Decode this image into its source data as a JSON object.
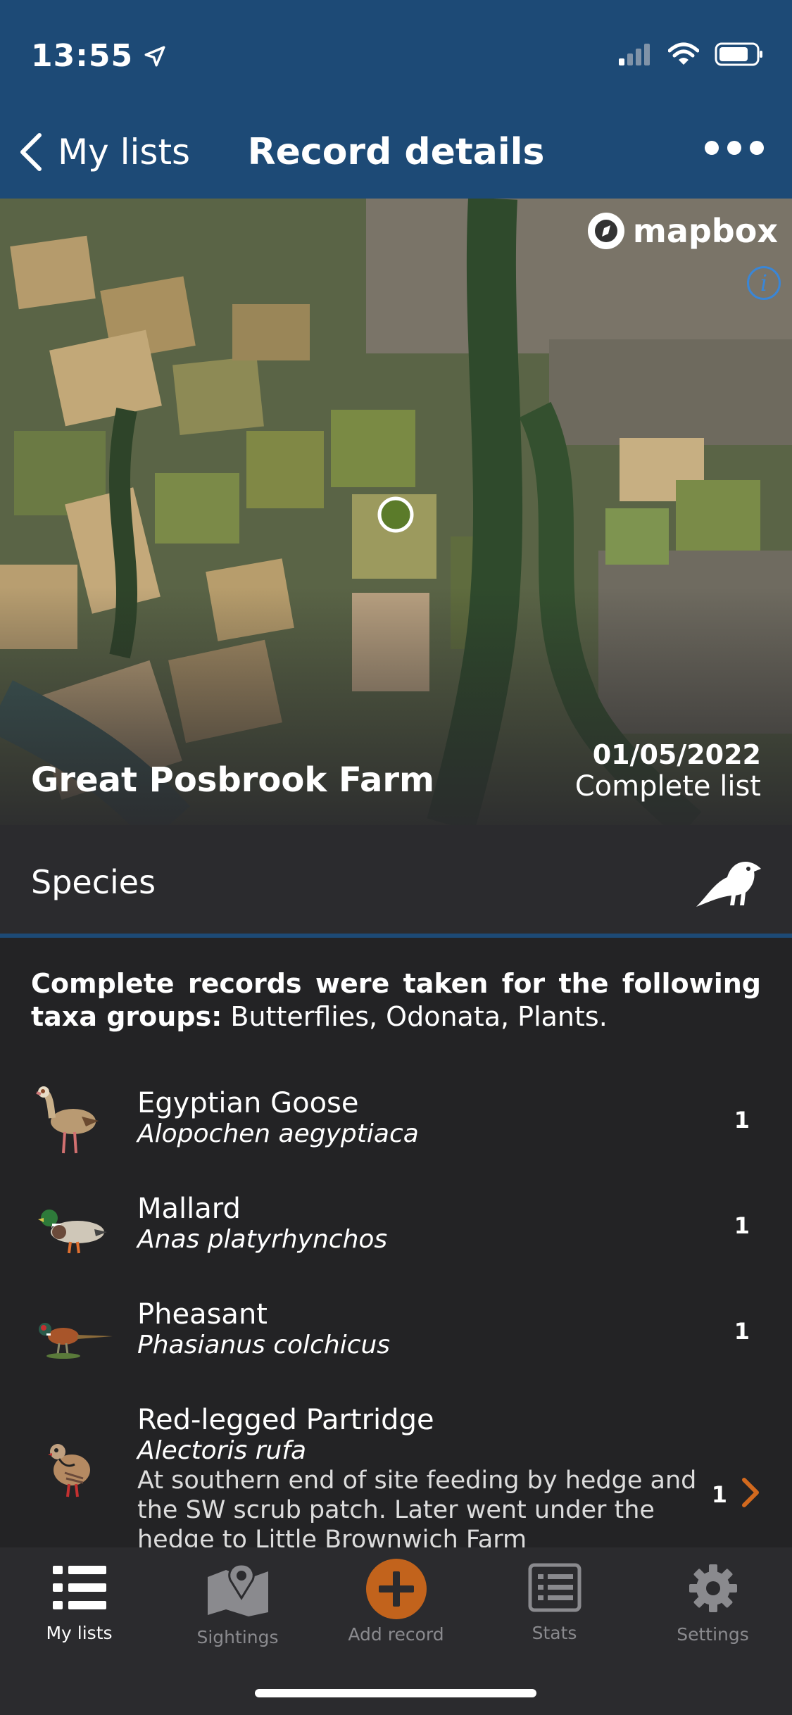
{
  "status_bar": {
    "time": "13:55"
  },
  "nav": {
    "back_label": "My lists",
    "title": "Record details"
  },
  "map": {
    "attribution": "mapbox",
    "info": "i"
  },
  "record": {
    "location": "Great Posbrook Farm",
    "date": "01/05/2022",
    "list_type": "Complete list"
  },
  "species_section": {
    "title": "Species"
  },
  "complete_note": {
    "prefix": "Complete records were taken for the following taxa groups:",
    "groups": " Butterflies, Odonata, Plants."
  },
  "species": [
    {
      "common": "Egyptian Goose",
      "latin": "Alopochen aegyptiaca",
      "count": "1"
    },
    {
      "common": "Mallard",
      "latin": "Anas platyrhynchos",
      "count": "1"
    },
    {
      "common": "Pheasant",
      "latin": "Phasianus colchicus",
      "count": "1"
    },
    {
      "common": "Red-legged Partridge",
      "latin": "Alectoris rufa",
      "count": "1",
      "note": "At southern end of site feeding by hedge and the SW scrub patch. Later went under the hedge to Little Brownwich Farm"
    }
  ],
  "tabs": [
    {
      "label": "My lists",
      "icon": "list-icon",
      "active": true
    },
    {
      "label": "Sightings",
      "icon": "map-marker-icon",
      "active": false
    },
    {
      "label": "Add record",
      "icon": "plus-circle-icon",
      "active": false
    },
    {
      "label": "Stats",
      "icon": "stats-list-icon",
      "active": false
    },
    {
      "label": "Settings",
      "icon": "gear-icon",
      "active": false
    }
  ],
  "colors": {
    "header": "#1d4a76",
    "accent": "#d2691e",
    "background": "#232325"
  }
}
